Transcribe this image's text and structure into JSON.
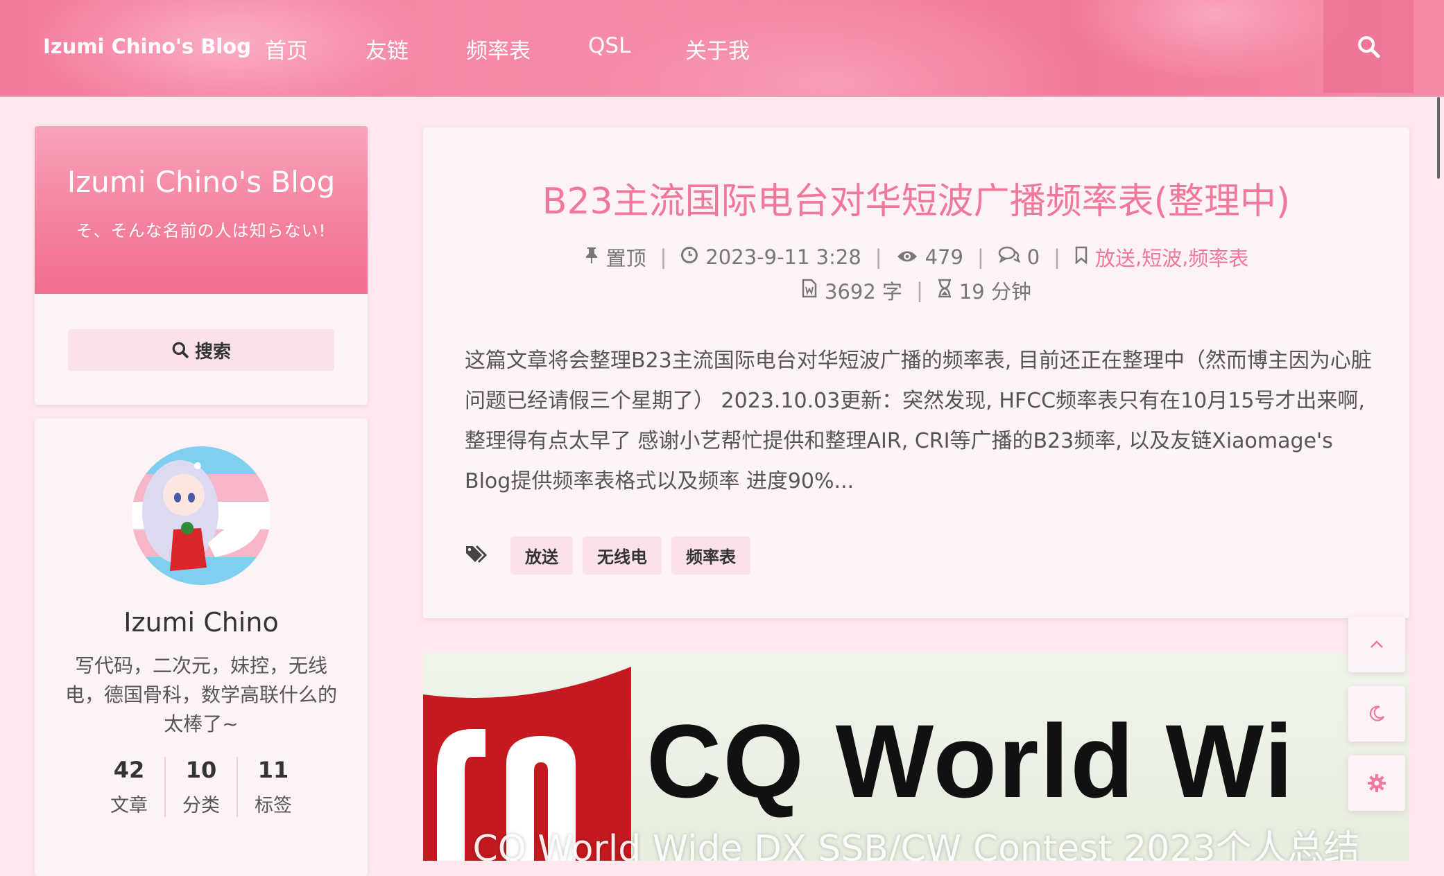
{
  "nav": {
    "brand": "Izumi Chino's Blog",
    "items": [
      "首页",
      "友链",
      "频率表",
      "QSL",
      "关于我"
    ]
  },
  "sidebar": {
    "site_title": "Izumi Chino's Blog",
    "site_subtitle": "そ、そんな名前の人は知らない!",
    "search_label": "搜索",
    "author_name": "Izumi Chino",
    "author_bio": "写代码，二次元，妹控，无线电，德国骨科，数学高联什么的太棒了~",
    "stats": [
      {
        "num": "42",
        "label": "文章"
      },
      {
        "num": "10",
        "label": "分类"
      },
      {
        "num": "11",
        "label": "标签"
      }
    ]
  },
  "post": {
    "title": "B23主流国际电台对华短波广播频率表(整理中)",
    "pinned": "置顶",
    "date": "2023-9-11 3:28",
    "views": "479",
    "comments": "0",
    "categories": [
      "放送",
      "短波",
      "频率表"
    ],
    "words": "3692 字",
    "read_time": "19 分钟",
    "excerpt": "这篇文章将会整理B23主流国际电台对华短波广播的频率表, 目前还正在整理中（然而博主因为心脏问题已经请假三个星期了） 2023.10.03更新：突然发现, HFCC频率表只有在10月15号才出来啊, 整理得有点太早了 感谢小艺帮忙提供和整理AIR, CRI等广播的B23频率, 以及友链Xiaomage's Blog提供频率表格式以及频率 进度90%...",
    "tags": [
      "放送",
      "无线电",
      "频率表"
    ]
  },
  "post2": {
    "image_text": "CQ World Wi",
    "title": "CQ World Wide DX SSB/CW Contest 2023个人总结"
  },
  "colors": {
    "accent": "#f0789b",
    "nav_bg": "#f47a9b",
    "page_bg": "#fde8ee"
  }
}
